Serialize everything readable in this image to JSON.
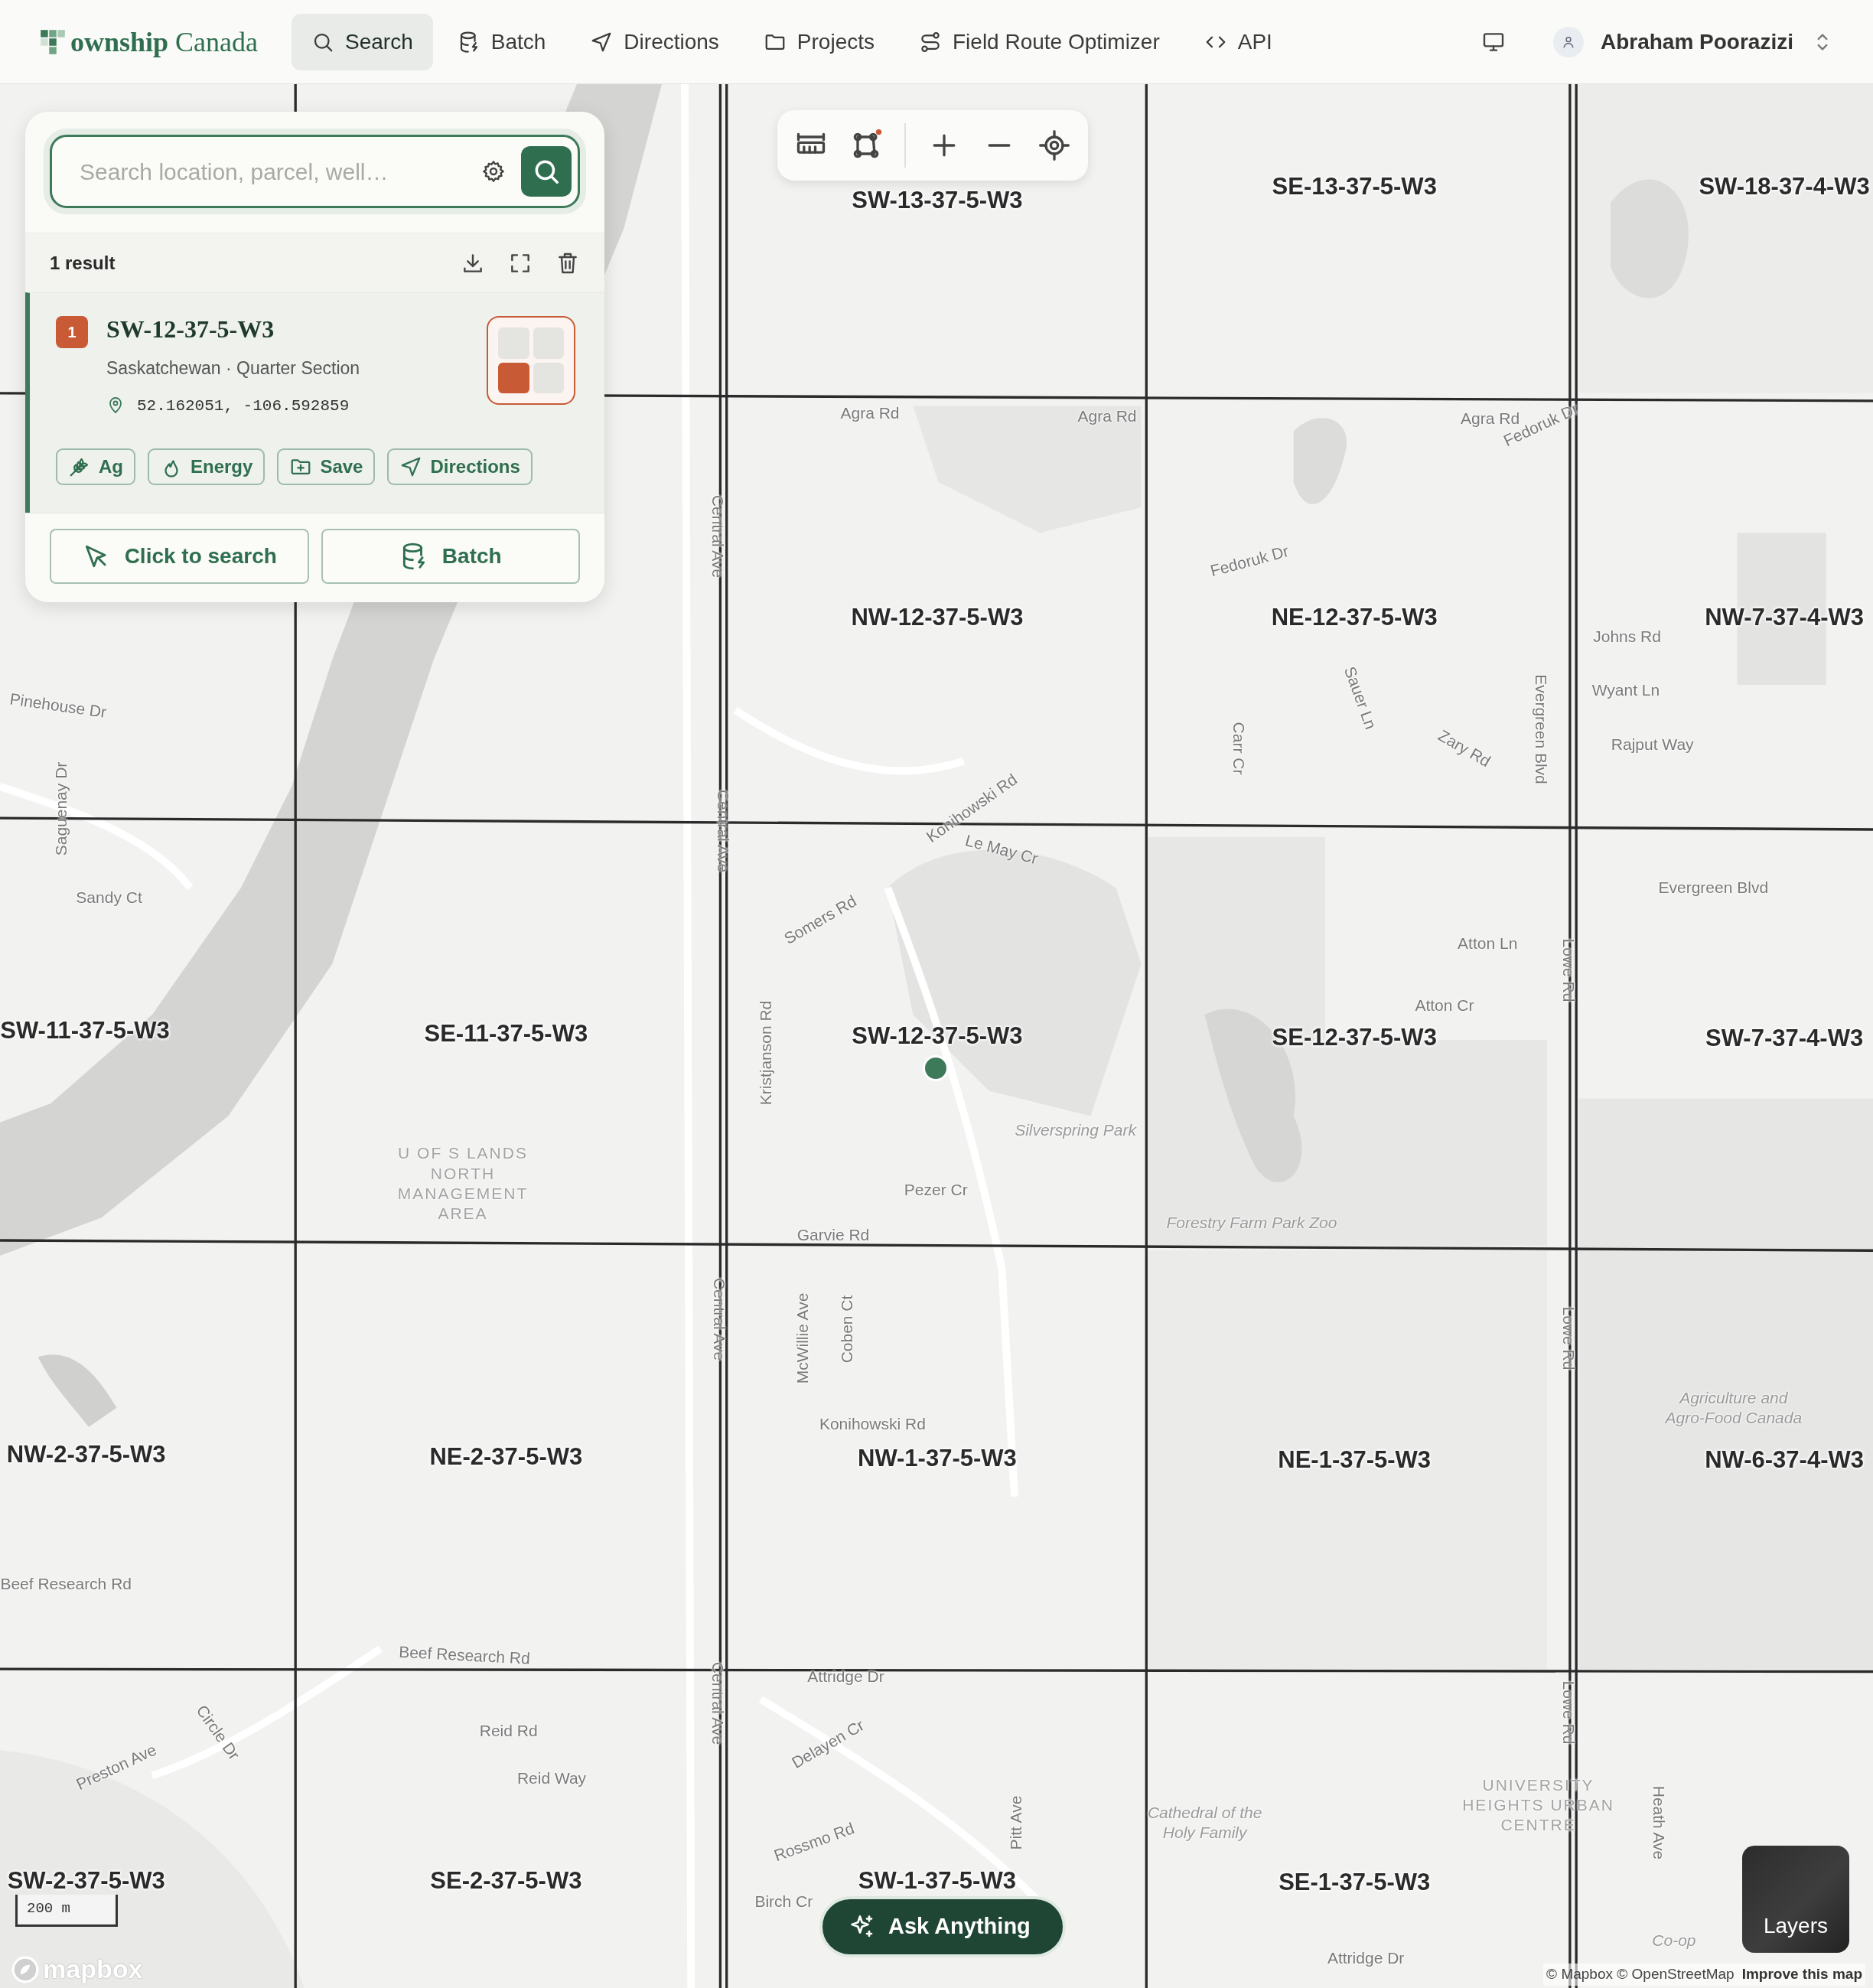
{
  "header": {
    "brand": "**ownship** Canada",
    "nav": [
      {
        "label": "Search",
        "kind": "search",
        "selected": true
      },
      {
        "label": "Batch",
        "kind": "batch",
        "selected": false
      },
      {
        "label": "Directions",
        "kind": "directions",
        "selected": false
      },
      {
        "label": "Projects",
        "kind": "projects",
        "selected": false
      },
      {
        "label": "Field Route Optimizer",
        "kind": "route",
        "selected": false
      },
      {
        "label": "API",
        "kind": "api",
        "selected": false
      }
    ],
    "user": {
      "name": "Abraham Poorazizi"
    }
  },
  "search_panel": {
    "search": {
      "placeholder": "Search location, parcel, well…"
    },
    "results_count": "1 result",
    "results": [
      {
        "number": "1",
        "title": "SW-12-37-5-W3",
        "subtitle": "Saskatchewan · Quarter Section",
        "coordinates": "52.162051, -106.592859",
        "selected": true,
        "quarters": [
          {
            "selected": false
          },
          {
            "selected": false
          },
          {
            "selected": true
          },
          {
            "selected": false
          }
        ],
        "actions": [
          {
            "label": "Ag",
            "kind": "ag"
          },
          {
            "label": "Energy",
            "kind": "energy"
          },
          {
            "label": "Save",
            "kind": "save"
          },
          {
            "label": "Directions",
            "kind": "directions"
          }
        ]
      }
    ],
    "buttons": [
      {
        "label": "Click to search",
        "kind": "click"
      },
      {
        "label": "Batch",
        "kind": "batch"
      }
    ]
  },
  "map": {
    "parcels": [
      "SW-13-37-5-W3",
      "SE-13-37-5-W3",
      "SW-18-37-4-W3",
      "NW-12-37-5-W3",
      "NE-12-37-5-W3",
      "NW-7-37-4-W3",
      "SW-11-37-5-W3",
      "SE-11-37-5-W3",
      "SW-12-37-5-W3",
      "SE-12-37-5-W3",
      "SW-7-37-4-W3",
      "NW-2-37-5-W3",
      "NE-2-37-5-W3",
      "NW-1-37-5-W3",
      "NE-1-37-5-W3",
      "NW-6-37-4-W3",
      "SW-2-37-5-W3",
      "SE-2-37-5-W3",
      "SW-1-37-5-W3",
      "SE-1-37-5-W3"
    ],
    "labels": [
      {
        "text": "Agra Rd",
        "kind": "street"
      },
      {
        "text": "Agra Rd",
        "kind": "street"
      },
      {
        "text": "Agra Rd",
        "kind": "street"
      },
      {
        "text": "Fedoruk Dr",
        "kind": "street"
      },
      {
        "text": "Fedoruk Dr",
        "kind": "street"
      },
      {
        "text": "Central Ave",
        "kind": "street"
      },
      {
        "text": "Central Ave",
        "kind": "street"
      },
      {
        "text": "Central Ave",
        "kind": "street"
      },
      {
        "text": "Central Ave",
        "kind": "street"
      },
      {
        "text": "Johns Rd",
        "kind": "street"
      },
      {
        "text": "Wyant Ln",
        "kind": "street"
      },
      {
        "text": "Rajput Way",
        "kind": "street"
      },
      {
        "text": "Sauer Ln",
        "kind": "street"
      },
      {
        "text": "Zary Rd",
        "kind": "street"
      },
      {
        "text": "Carr Cr",
        "kind": "street"
      },
      {
        "text": "Evergreen Blvd",
        "kind": "street"
      },
      {
        "text": "Evergreen Blvd",
        "kind": "street"
      },
      {
        "text": "Pinehouse Dr",
        "kind": "street"
      },
      {
        "text": "Saguenay Dr",
        "kind": "street"
      },
      {
        "text": "Sandy Ct",
        "kind": "street"
      },
      {
        "text": "Konihowski Rd",
        "kind": "street"
      },
      {
        "text": "Le May Cr",
        "kind": "street"
      },
      {
        "text": "Somers Rd",
        "kind": "street"
      },
      {
        "text": "Atton Ln",
        "kind": "street"
      },
      {
        "text": "Atton Cr",
        "kind": "street"
      },
      {
        "text": "Lowe Rd",
        "kind": "street"
      },
      {
        "text": "Kristjanson Rd",
        "kind": "street"
      },
      {
        "text": "Silverspring Park",
        "kind": "place"
      },
      {
        "text": "Pezer Cr",
        "kind": "street"
      },
      {
        "text": "Garvie Rd",
        "kind": "street"
      },
      {
        "text": "Forestry Farm Park Zoo",
        "kind": "place"
      },
      {
        "text": "U OF S LANDS NORTH MANAGEMENT AREA",
        "kind": "area"
      },
      {
        "text": "McWillie Ave",
        "kind": "street"
      },
      {
        "text": "Coben Ct",
        "kind": "street"
      },
      {
        "text": "Konihowski Rd",
        "kind": "street"
      },
      {
        "text": "Lowe Rd",
        "kind": "street"
      },
      {
        "text": "Agriculture and Agro-Food Canada",
        "kind": "place"
      },
      {
        "text": "Beef Research Rd",
        "kind": "street"
      },
      {
        "text": "Beef Research Rd",
        "kind": "street"
      },
      {
        "text": "Attridge Dr",
        "kind": "street"
      },
      {
        "text": "Lowe Rd",
        "kind": "street"
      },
      {
        "text": "Circle Dr",
        "kind": "street"
      },
      {
        "text": "Preston Ave",
        "kind": "street"
      },
      {
        "text": "Reid Rd",
        "kind": "street"
      },
      {
        "text": "Reid Way",
        "kind": "street"
      },
      {
        "text": "Delayen Cr",
        "kind": "street"
      },
      {
        "text": "Pitt Ave",
        "kind": "street"
      },
      {
        "text": "Rossmo Rd",
        "kind": "street"
      },
      {
        "text": "Birch Cr",
        "kind": "street"
      },
      {
        "text": "Cathedral of the Holy Family",
        "kind": "place"
      },
      {
        "text": "UNIVERSITY HEIGHTS URBAN CENTRE",
        "kind": "area"
      },
      {
        "text": "Heath Ave",
        "kind": "street"
      },
      {
        "text": "Co-op",
        "kind": "place"
      },
      {
        "text": "Attridge Dr",
        "kind": "street"
      }
    ],
    "scale": "200 m",
    "logo": "mapbox",
    "attribution": "© Mapbox © OpenStreetMap",
    "improve_link": "Improve this map",
    "ask_button": "Ask Anything",
    "layers_button": "Layers"
  }
}
